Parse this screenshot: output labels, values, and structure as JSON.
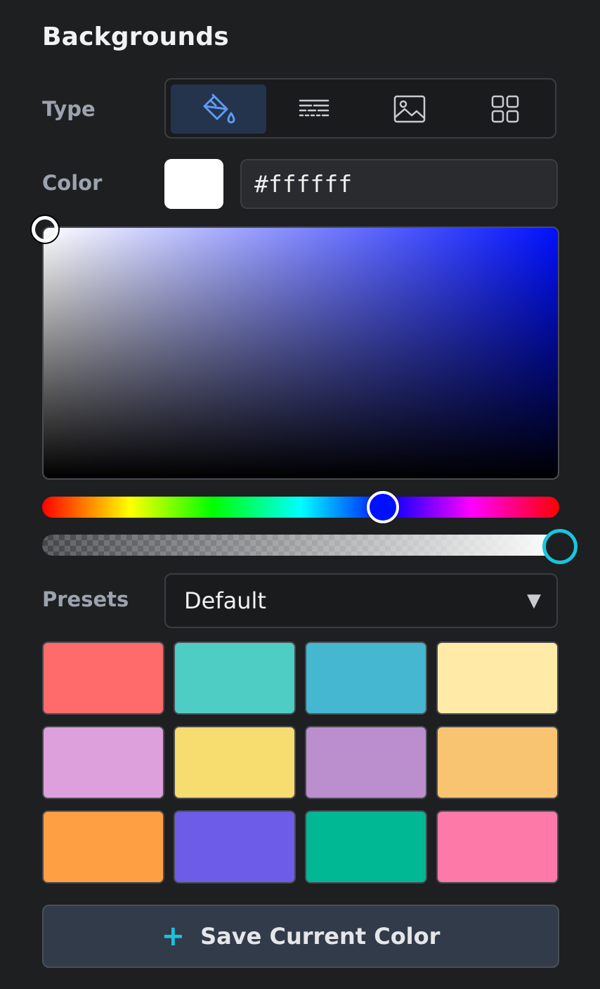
{
  "panel": {
    "title": "Backgrounds"
  },
  "type": {
    "label": "Type",
    "options": [
      {
        "icon": "paint-bucket-icon",
        "active": true
      },
      {
        "icon": "gradient-lines-icon",
        "active": false
      },
      {
        "icon": "image-icon",
        "active": false
      },
      {
        "icon": "pattern-grid-icon",
        "active": false
      }
    ]
  },
  "color": {
    "label": "Color",
    "hex_value": "#ffffff",
    "swatch_color": "#ffffff",
    "hue_color": "#0010ff",
    "alpha_percent": 100
  },
  "presets": {
    "label": "Presets",
    "selected": "Default",
    "caret": "▼",
    "swatches": [
      "#ff6b6b",
      "#4ecdc4",
      "#45b7d1",
      "#ffeaa7",
      "#dda0dd",
      "#f7dc6f",
      "#bb8fce",
      "#f8c471",
      "#ff9f43",
      "#6c5ce7",
      "#00b894",
      "#fd79a8"
    ]
  },
  "save_button": {
    "icon": "plus-icon",
    "plus": "+",
    "label": "Save Current Color"
  },
  "colors": {
    "accent": "#19c4de",
    "active_type_icon": "#5b9bf5"
  }
}
